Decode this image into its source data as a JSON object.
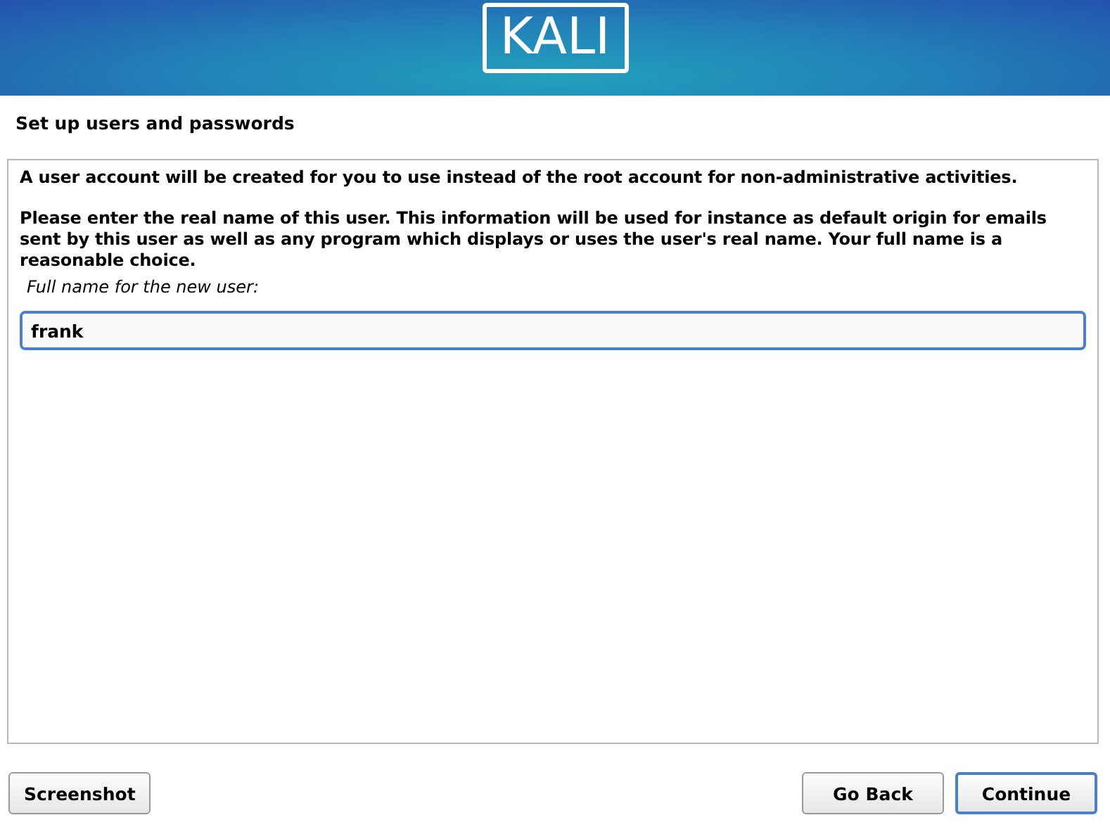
{
  "header": {
    "logo": "KALI"
  },
  "title": "Set up users and passwords",
  "panel": {
    "paragraphs": [
      "A user account will be created for you to use instead of the root account for non-administrative activities.",
      "Please enter the real name of this user. This information will be used for instance as default origin for emails sent by this user as well as any program which displays or uses the user's real name. Your full name is a reasonable choice."
    ],
    "field_label": "Full name for the new user:",
    "field": {
      "value": "frank",
      "focused": true
    }
  },
  "left_buttons": [
    {
      "label": "Screenshot",
      "focused": false
    }
  ],
  "right_buttons": [
    {
      "label": "Go Back",
      "focused": false
    },
    {
      "label": "Continue",
      "focused": true
    }
  ]
}
